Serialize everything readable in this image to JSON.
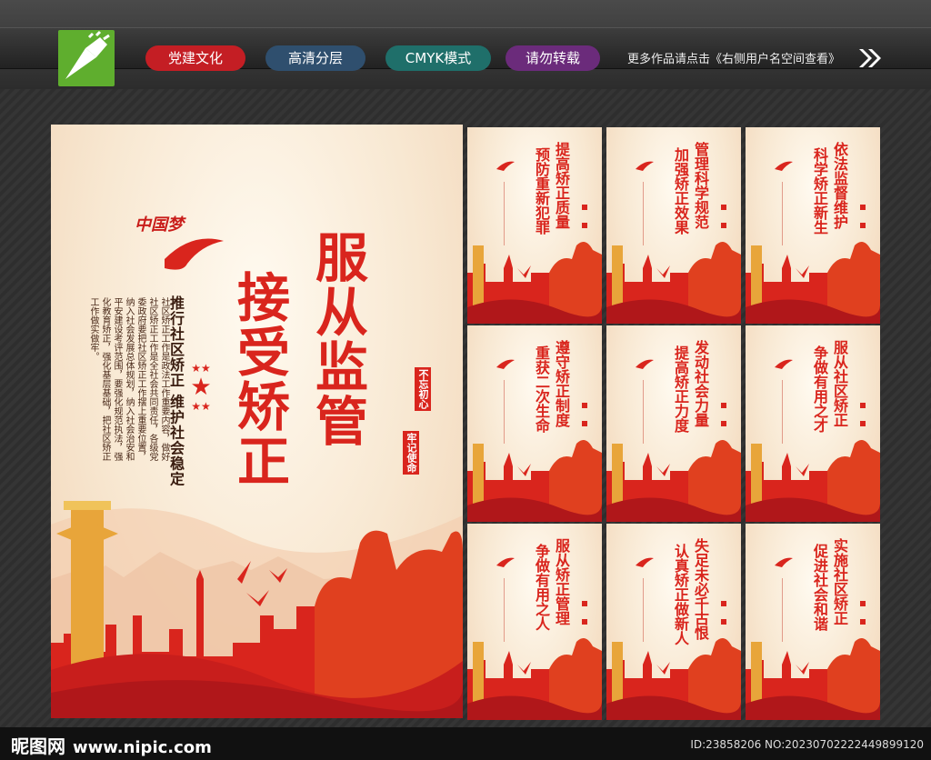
{
  "toolbar": {
    "pills": [
      {
        "label": "党建文化",
        "color": "#c41e24"
      },
      {
        "label": "高清分层",
        "color": "#2f4f6e"
      },
      {
        "label": "CMYK模式",
        "color": "#1f6f6a"
      },
      {
        "label": "请勿转载",
        "color": "#6b2b7b"
      }
    ],
    "more_text": "更多作品请点击《右侧用户名空间查看》"
  },
  "main_poster": {
    "logo_text": "中国梦",
    "title_line1": "服从监管",
    "title_line2": "接受矫正",
    "subtitle": "推行社区矫正 维护社会稳定",
    "stamp1": "不忘初心",
    "stamp2": "牢记使命",
    "body_text": "社区矫正工作是政法工作重要内容，做好社区矫正工作是全社会共同责任，各级党委政府要把社区矫正工作摆上重要位置，纳入社会发展总体规划，纳入社会治安和平安建设考评范围，要强化规范执法，强化教育矫正，强化基层基础，把社区矫正工作做实做牢。"
  },
  "small_posters": [
    {
      "line1": "提高矫正质量",
      "line2": "预防重新犯罪"
    },
    {
      "line1": "管理科学规范",
      "line2": "加强矫正效果"
    },
    {
      "line1": "依法监督维护",
      "line2": "科学矫正新生"
    },
    {
      "line1": "遵守矫正制度",
      "line2": "重获二次生命"
    },
    {
      "line1": "发动社会力量",
      "line2": "提高矫正力度"
    },
    {
      "line1": "服从社区矫正",
      "line2": "争做有用之才"
    },
    {
      "line1": "服从矫正管理",
      "line2": "争做有用之人"
    },
    {
      "line1": "失足未必千古恨",
      "line2": "认真矫正做新人"
    },
    {
      "line1": "实施社区矫正",
      "line2": "促进社会和谐"
    }
  ],
  "footer": {
    "site_name": "昵图网",
    "site_url": "www.nipic.com",
    "id_text": "ID:23858206 NO:20230702222449899120"
  },
  "colors": {
    "accent": "#d9251d",
    "background": "#3a3a3a"
  }
}
